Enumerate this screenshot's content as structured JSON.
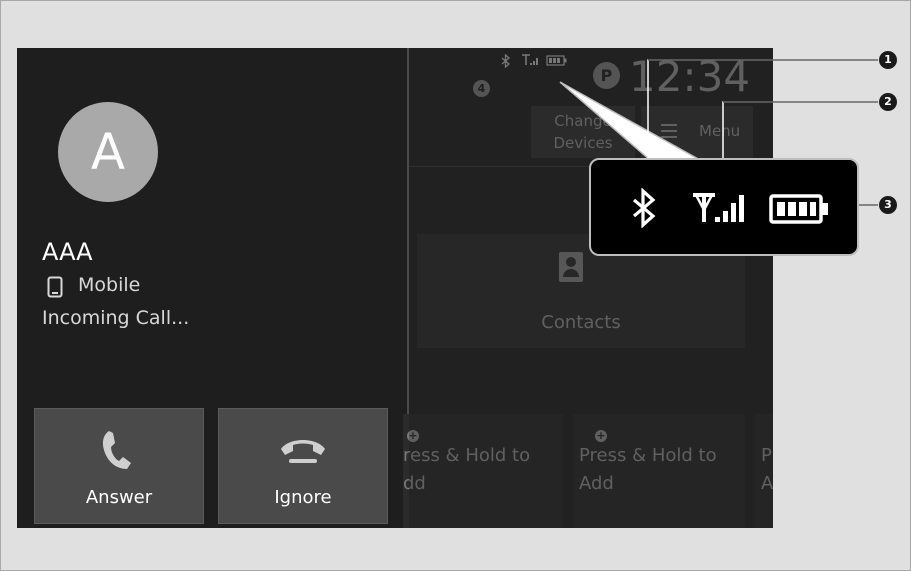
{
  "caller": {
    "avatar_letter": "A",
    "name": "AAA",
    "type": "Mobile",
    "status": "Incoming Call..."
  },
  "buttons": {
    "answer_label": "Answer",
    "ignore_label": "Ignore"
  },
  "right_panel": {
    "badge_number": "4",
    "park_label": "P",
    "clock": "12:34",
    "change_devices_line1": "Change",
    "change_devices_line2": "Devices",
    "menu_label": "Menu",
    "contacts_label": "Contacts",
    "favorite_slot_line1": "Press & Hold to",
    "favorite_slot_line2": "Add",
    "favorite_slot_partial1": "ress & Hold to",
    "favorite_slot_partial2": "dd",
    "favorite_slot_partial3a": "P",
    "favorite_slot_partial3b": "A"
  },
  "callout": {
    "icons": [
      "bluetooth-icon",
      "signal-strength-icon",
      "battery-icon"
    ],
    "markers": [
      "1",
      "2",
      "3"
    ]
  },
  "colors": {
    "screen_bg": "#222222",
    "button_bg": "#4a4a4a",
    "avatar_bg": "#a9a9a9"
  }
}
